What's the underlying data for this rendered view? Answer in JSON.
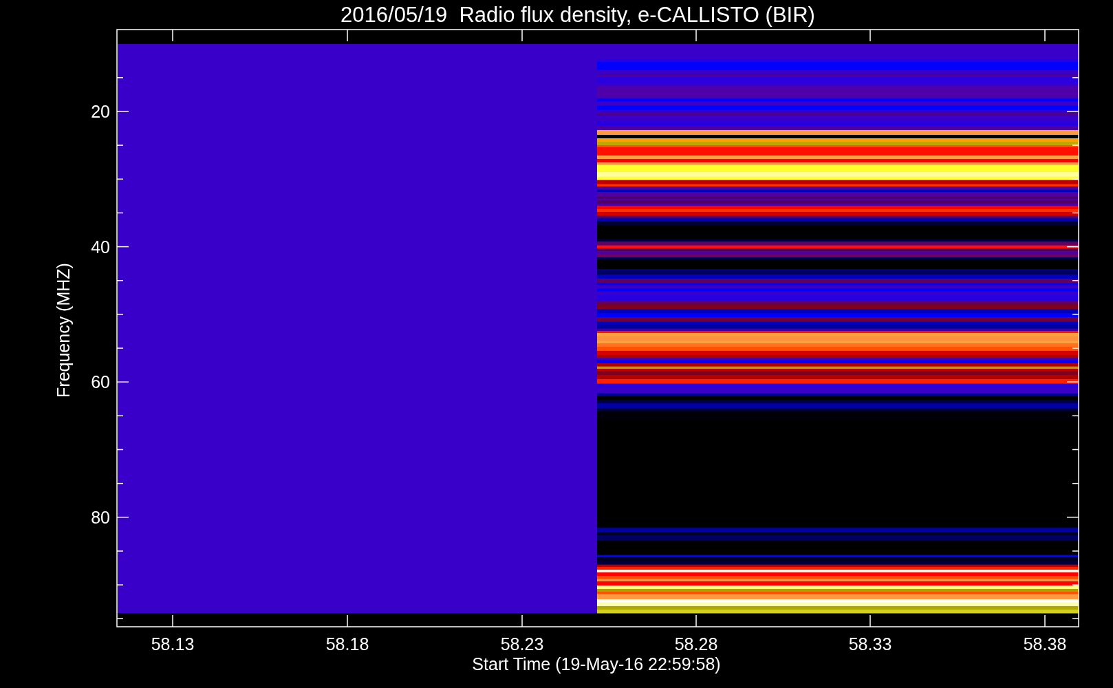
{
  "title": "2016/05/19  Radio flux density, e-CALLISTO (BIR)",
  "y_axis": {
    "label": "Frequency (MHZ)",
    "tick_labels": [
      "20",
      "40",
      "60",
      "80"
    ]
  },
  "x_axis": {
    "label": "Start Time (19-May-16 22:59:58)",
    "tick_labels": [
      "58.13",
      "58.18",
      "58.23",
      "58.28",
      "58.33",
      "58.38"
    ]
  }
}
